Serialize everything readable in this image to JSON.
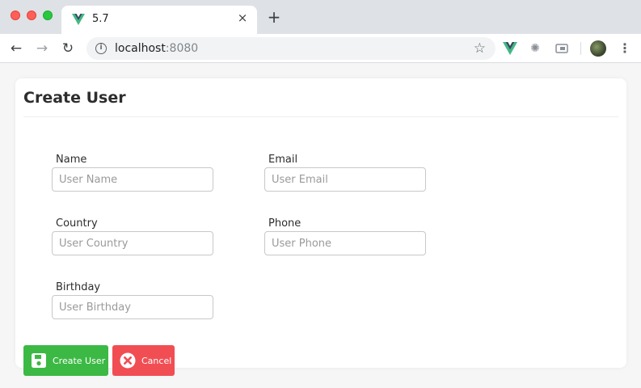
{
  "browser": {
    "tab": {
      "title": "5.7",
      "close": "×"
    },
    "new_tab": "+",
    "url_host": "localhost",
    "url_port": ":8080",
    "info_icon": "i",
    "star": "☆",
    "nav": {
      "back": "←",
      "forward": "→",
      "reload": "↻"
    },
    "menu": "⋮",
    "bug_glyph": "✺"
  },
  "page": {
    "title": "Create User",
    "fields": {
      "name": {
        "label": "Name",
        "placeholder": "User Name"
      },
      "email": {
        "label": "Email",
        "placeholder": "User Email"
      },
      "country": {
        "label": "Country",
        "placeholder": "User Country"
      },
      "phone": {
        "label": "Phone",
        "placeholder": "User Phone"
      },
      "birthday": {
        "label": "Birthday",
        "placeholder": "User Birthday"
      }
    },
    "buttons": {
      "create": "Create User",
      "cancel": "Cancel"
    }
  },
  "colors": {
    "create_button": "#3cb944",
    "cancel_button": "#f14e53",
    "vue_green": "#41b883",
    "vue_dark": "#35495e"
  }
}
